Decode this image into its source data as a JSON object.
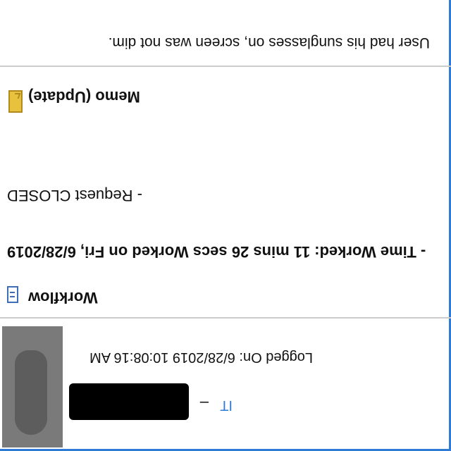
{
  "window": {
    "orientation": "upside-down",
    "accent_color": "#2e7bd6"
  },
  "note": {
    "text": "User had his sunglasses on, screen was not dim."
  },
  "memo": {
    "icon": "memo-icon",
    "label": "Memo (Update)"
  },
  "workflow": {
    "icon": "document-icon",
    "label": "Workflow",
    "lines": [
      "- Time Worked: 11 mins 26 secs Worked on Fri, 6/28/2019",
      "- Request CLOSED"
    ]
  },
  "log_entry": {
    "logged_on": "Logged On: 6/28/2019 10:08:16 AM",
    "author_department": "IT",
    "separator": "–",
    "author_name_redacted": true,
    "avatar": "avatar-silhouette"
  }
}
